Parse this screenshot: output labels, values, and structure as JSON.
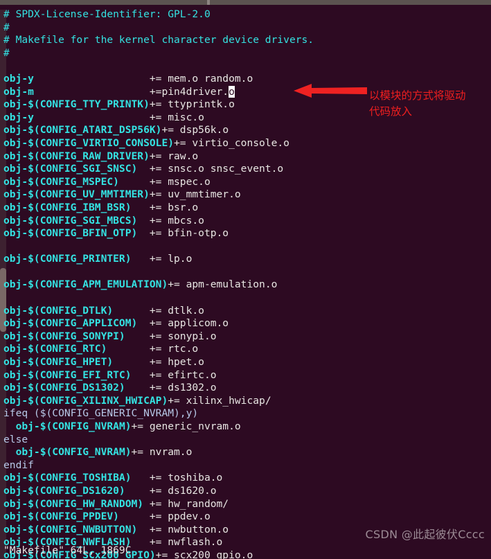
{
  "window": {
    "titlebar_visible": true
  },
  "editor": {
    "name": "vim",
    "filename": "Makefile",
    "background_color": "#2d0a22",
    "comment_color": "#34e2e2",
    "variable_color": "#34e2e2",
    "value_color": "#e8e6e3",
    "keyword_color": "#b7c9e8",
    "cursor": {
      "line": 7,
      "char": "o",
      "color": "#ffffff"
    },
    "lines": [
      {
        "n": 1,
        "type": "comment",
        "text": "# SPDX-License-Identifier: GPL-2.0"
      },
      {
        "n": 2,
        "type": "comment",
        "text": "#"
      },
      {
        "n": 3,
        "type": "comment",
        "text": "# Makefile for the kernel character device drivers."
      },
      {
        "n": 4,
        "type": "comment",
        "text": "#"
      },
      {
        "n": 5,
        "type": "blank",
        "text": ""
      },
      {
        "n": 6,
        "type": "rule",
        "var": "obj-y",
        "op": "+= ",
        "val": "mem.o random.o",
        "pad": 21
      },
      {
        "n": 7,
        "type": "rule-cursor",
        "var": "obj-m",
        "op": "+=",
        "val": "pin4driver.",
        "cursor_char": "o",
        "pad": 21
      },
      {
        "n": 8,
        "type": "rule",
        "var": "obj-$(CONFIG_TTY_PRINTK)",
        "op": "+= ",
        "val": "ttyprintk.o",
        "pad": 21
      },
      {
        "n": 9,
        "type": "rule",
        "var": "obj-y",
        "op": "+= ",
        "val": "misc.o",
        "pad": 21
      },
      {
        "n": 10,
        "type": "rule",
        "var": "obj-$(CONFIG_ATARI_DSP56K)",
        "op": "+= ",
        "val": "dsp56k.o",
        "pad": 21
      },
      {
        "n": 11,
        "type": "rule",
        "var": "obj-$(CONFIG_VIRTIO_CONSOLE)",
        "op": "+= ",
        "val": "virtio_console.o",
        "pad": 21
      },
      {
        "n": 12,
        "type": "rule",
        "var": "obj-$(CONFIG_RAW_DRIVER)",
        "op": "+= ",
        "val": "raw.o",
        "pad": 21
      },
      {
        "n": 13,
        "type": "rule",
        "var": "obj-$(CONFIG_SGI_SNSC)",
        "op": "+= ",
        "val": "snsc.o snsc_event.o",
        "pad": 21
      },
      {
        "n": 14,
        "type": "rule",
        "var": "obj-$(CONFIG_MSPEC)",
        "op": "+= ",
        "val": "mspec.o",
        "pad": 21
      },
      {
        "n": 15,
        "type": "rule",
        "var": "obj-$(CONFIG_UV_MMTIMER)",
        "op": "+= ",
        "val": "uv_mmtimer.o",
        "pad": 21
      },
      {
        "n": 16,
        "type": "rule",
        "var": "obj-$(CONFIG_IBM_BSR)",
        "op": "+= ",
        "val": "bsr.o",
        "pad": 21
      },
      {
        "n": 17,
        "type": "rule",
        "var": "obj-$(CONFIG_SGI_MBCS)",
        "op": "+= ",
        "val": "mbcs.o",
        "pad": 21
      },
      {
        "n": 18,
        "type": "rule",
        "var": "obj-$(CONFIG_BFIN_OTP)",
        "op": "+= ",
        "val": "bfin-otp.o",
        "pad": 21
      },
      {
        "n": 19,
        "type": "blank",
        "text": ""
      },
      {
        "n": 20,
        "type": "rule",
        "var": "obj-$(CONFIG_PRINTER)",
        "op": "+= ",
        "val": "lp.o",
        "pad": 21
      },
      {
        "n": 21,
        "type": "blank",
        "text": ""
      },
      {
        "n": 22,
        "type": "rule",
        "var": "obj-$(CONFIG_APM_EMULATION)",
        "op": "+= ",
        "val": "apm-emulation.o",
        "pad": 21
      },
      {
        "n": 23,
        "type": "blank",
        "text": ""
      },
      {
        "n": 24,
        "type": "rule",
        "var": "obj-$(CONFIG_DTLK)",
        "op": "+= ",
        "val": "dtlk.o",
        "pad": 21
      },
      {
        "n": 25,
        "type": "rule",
        "var": "obj-$(CONFIG_APPLICOM)",
        "op": "+= ",
        "val": "applicom.o",
        "pad": 21
      },
      {
        "n": 26,
        "type": "rule",
        "var": "obj-$(CONFIG_SONYPI)",
        "op": "+= ",
        "val": "sonypi.o",
        "pad": 21
      },
      {
        "n": 27,
        "type": "rule",
        "var": "obj-$(CONFIG_RTC)",
        "op": "+= ",
        "val": "rtc.o",
        "pad": 21
      },
      {
        "n": 28,
        "type": "rule",
        "var": "obj-$(CONFIG_HPET)",
        "op": "+= ",
        "val": "hpet.o",
        "pad": 21
      },
      {
        "n": 29,
        "type": "rule",
        "var": "obj-$(CONFIG_EFI_RTC)",
        "op": "+= ",
        "val": "efirtc.o",
        "pad": 21
      },
      {
        "n": 30,
        "type": "rule",
        "var": "obj-$(CONFIG_DS1302)",
        "op": "+= ",
        "val": "ds1302.o",
        "pad": 21
      },
      {
        "n": 31,
        "type": "rule",
        "var": "obj-$(CONFIG_XILINX_HWICAP)",
        "op": "+= ",
        "val": "xilinx_hwicap/",
        "pad": 21
      },
      {
        "n": 32,
        "type": "keyword",
        "text": "ifeq ($(CONFIG_GENERIC_NVRAM),y)"
      },
      {
        "n": 33,
        "type": "rule-indent",
        "indent": "  ",
        "var": "obj-$(CONFIG_NVRAM)",
        "op": "+= ",
        "val": "generic_nvram.o",
        "pad": 13
      },
      {
        "n": 34,
        "type": "keyword",
        "text": "else"
      },
      {
        "n": 35,
        "type": "rule-indent",
        "indent": "  ",
        "var": "obj-$(CONFIG_NVRAM)",
        "op": "+= ",
        "val": "nvram.o",
        "pad": 13
      },
      {
        "n": 36,
        "type": "keyword",
        "text": "endif"
      },
      {
        "n": 37,
        "type": "rule",
        "var": "obj-$(CONFIG_TOSHIBA)",
        "op": "+= ",
        "val": "toshiba.o",
        "pad": 21
      },
      {
        "n": 38,
        "type": "rule",
        "var": "obj-$(CONFIG_DS1620)",
        "op": "+= ",
        "val": "ds1620.o",
        "pad": 21
      },
      {
        "n": 39,
        "type": "rule",
        "var": "obj-$(CONFIG_HW_RANDOM)",
        "op": "+= ",
        "val": "hw_random/",
        "pad": 21
      },
      {
        "n": 40,
        "type": "rule",
        "var": "obj-$(CONFIG_PPDEV)",
        "op": "+= ",
        "val": "ppdev.o",
        "pad": 21
      },
      {
        "n": 41,
        "type": "rule",
        "var": "obj-$(CONFIG_NWBUTTON)",
        "op": "+= ",
        "val": "nwbutton.o",
        "pad": 21
      },
      {
        "n": 42,
        "type": "rule",
        "var": "obj-$(CONFIG_NWFLASH)",
        "op": "+= ",
        "val": "nwflash.o",
        "pad": 21
      },
      {
        "n": 43,
        "type": "rule",
        "var": "obj-$(CONFIG_SCx200_GPIO)",
        "op": "+= ",
        "val": "scx200_gpio.o",
        "pad": 21
      }
    ],
    "status_line": "\"Makefile\" 64L, 1869C"
  },
  "annotation": {
    "text": "以模块的方式将驱动\n代码放入",
    "color": "#ee1f1f",
    "arrow": "left-arrow"
  },
  "watermark": {
    "text": "CSDN @此起彼伏Cccc"
  },
  "scrollbar": {
    "orientation": "vertical",
    "position": "left"
  }
}
